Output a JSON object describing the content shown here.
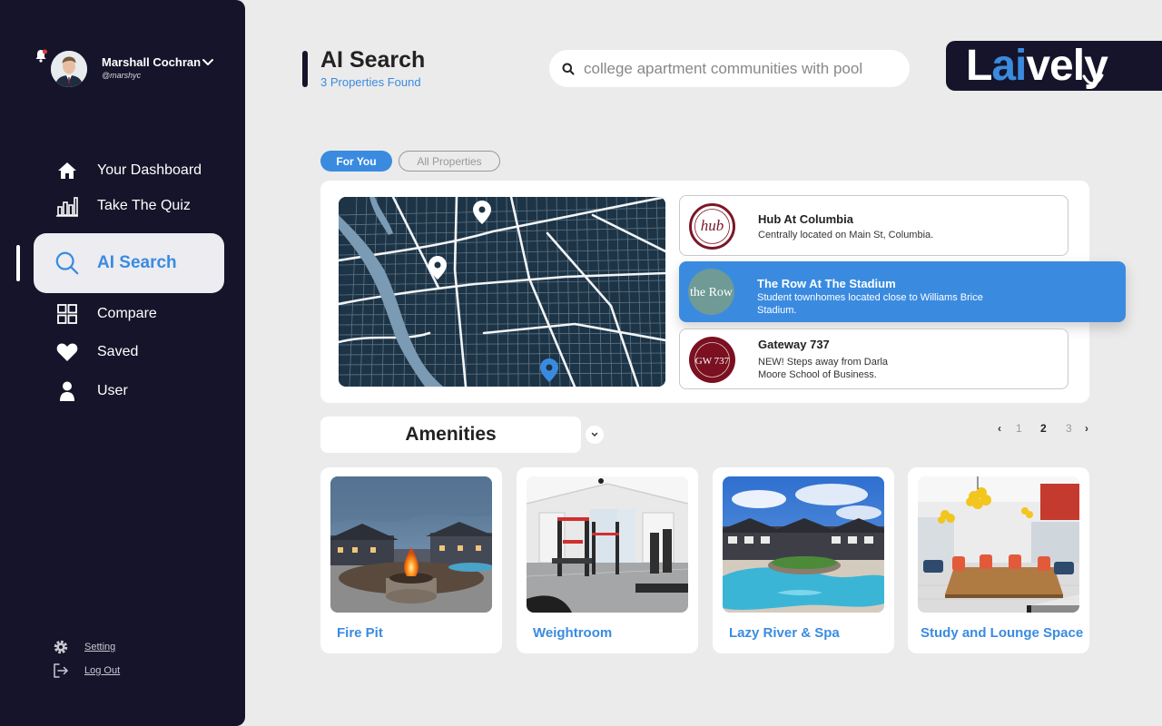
{
  "user": {
    "name": "Marshall Cochran",
    "handle": "@marshyc"
  },
  "nav": [
    {
      "label": "Your Dashboard",
      "icon": "home-icon"
    },
    {
      "label": "Take The Quiz",
      "icon": "bar-chart-icon"
    },
    {
      "label": "AI Search",
      "icon": "search-icon",
      "active": true
    },
    {
      "label": "Compare",
      "icon": "grid-icon"
    },
    {
      "label": "Saved",
      "icon": "heart-icon"
    },
    {
      "label": "User",
      "icon": "user-icon"
    }
  ],
  "footer_links": [
    {
      "label": "Setting",
      "icon": "gear-icon"
    },
    {
      "label": "Log Out",
      "icon": "logout-icon"
    }
  ],
  "header": {
    "title": "AI Search",
    "subtitle": "3 Properties Found",
    "search_value": "college apartment communities with pool"
  },
  "brand": {
    "prefix": "L",
    "accent": "ai",
    "suffix": "vely"
  },
  "tabs": [
    {
      "label": "For You",
      "active": true
    },
    {
      "label": "All Properties",
      "active": false
    }
  ],
  "properties": [
    {
      "name": "Hub At Columbia",
      "desc": "Centrally located on Main St, Columbia.",
      "logo_text": "hub"
    },
    {
      "name": "The Row At The Stadium",
      "desc": "Student townhomes located close to Williams Brice Stadium.",
      "logo_text": "the Row",
      "selected": true
    },
    {
      "name": "Gateway 737",
      "desc": "NEW! Steps away from Darla Moore School of Business.",
      "logo_text": "GW 737"
    }
  ],
  "amenities": {
    "title": "Amenities",
    "pages": [
      "1",
      "2",
      "3"
    ],
    "current_page": "2",
    "items": [
      {
        "label": "Fire Pit"
      },
      {
        "label": "Weightroom"
      },
      {
        "label": "Lazy River & Spa"
      },
      {
        "label": "Study and Lounge Space"
      }
    ]
  },
  "colors": {
    "sidebar": "#16142a",
    "accent": "#3a8be0",
    "background": "#ebebeb"
  }
}
